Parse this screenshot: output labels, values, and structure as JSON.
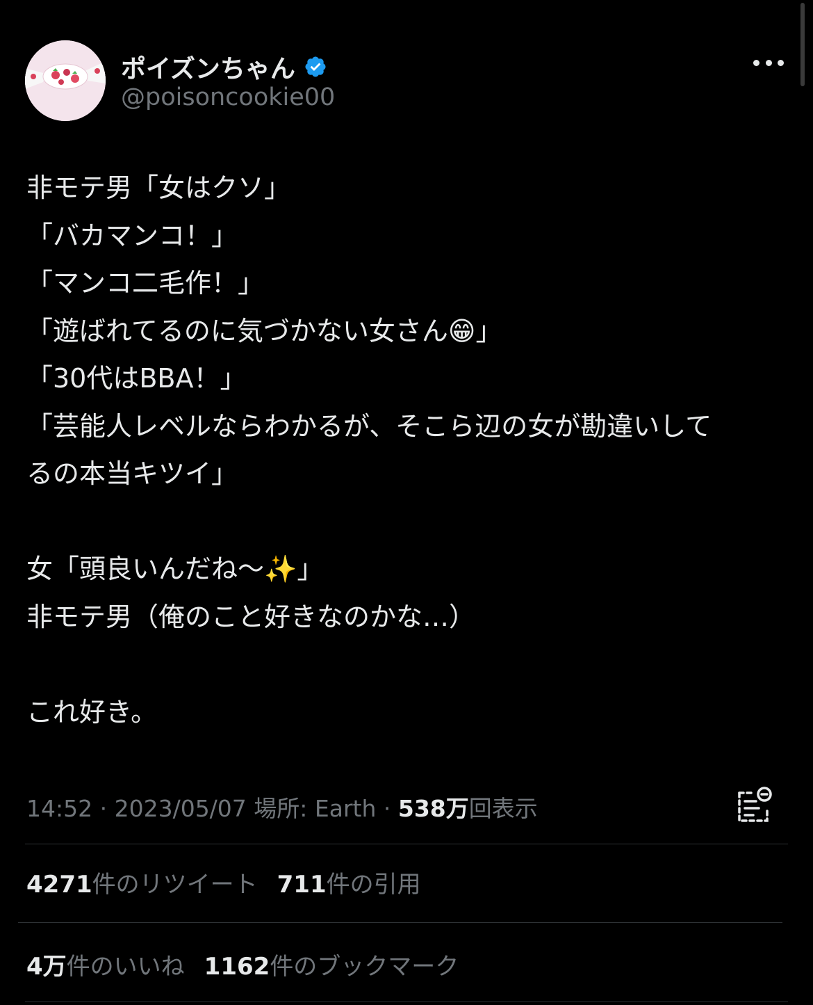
{
  "user": {
    "display_name": "ポイズンちゃん",
    "handle": "@poisoncookie00",
    "verified": true,
    "verified_badge_icon": "verified-badge-icon",
    "avatar_icon": "candy-avatar"
  },
  "menu_icon": "more-options-icon",
  "tweet": {
    "lines": [
      "非モテ男「女はクソ」",
      "「バカマンコ！」",
      "「マンコ二毛作！」",
      "「遊ばれてるのに気づかない女さん😁」",
      "「30代はBBA！」",
      "「芸能人レベルならわかるが、そこら辺の女が勘違いして",
      "るの本当キツイ」",
      "",
      "女「頭良いんだね〜✨」",
      "非モテ男（俺のこと好きなのかな…）",
      "",
      "これ好き。"
    ]
  },
  "meta": {
    "time": "14:52",
    "separator1": " · ",
    "date": "2023/05/07",
    "location_label": " 場所: Earth",
    "separator2": " · ",
    "views_count": "538万",
    "views_label": "回表示",
    "analytics_icon": "view-analytics-icon"
  },
  "stats": {
    "retweets_count": "4271",
    "retweets_label": "件のリツイート",
    "quotes_count": "711",
    "quotes_label": "件の引用",
    "likes_count": "4万",
    "likes_label": "件のいいね",
    "bookmarks_count": "1162",
    "bookmarks_label": "件のブックマーク"
  },
  "colors": {
    "background": "#000000",
    "text_primary": "#e7e9ea",
    "text_secondary": "#71767b",
    "divider": "#2f3336",
    "verified_blue": "#1d9bf0"
  }
}
